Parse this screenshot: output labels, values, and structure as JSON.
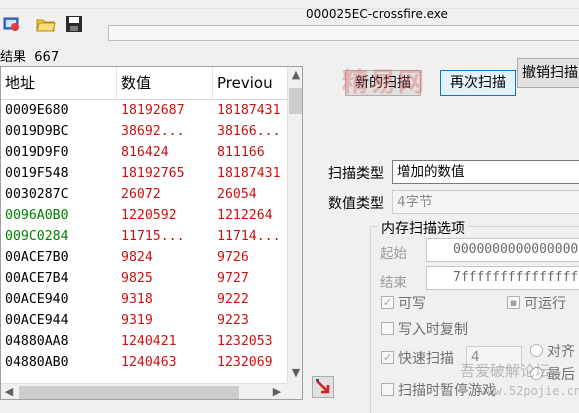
{
  "process_title": "000025EC-crossfire.exe",
  "toolbar": {
    "icons": [
      "process-select-icon",
      "open-file-icon",
      "save-icon"
    ]
  },
  "results": {
    "label": "结果",
    "count": "667"
  },
  "list": {
    "headers": {
      "address": "地址",
      "value": "数值",
      "previous": "Previou"
    },
    "rows": [
      {
        "address": "0009E680",
        "value": "18192687",
        "previous": "18187431",
        "color": "#000000"
      },
      {
        "address": "0019D9BC",
        "value": "38692...",
        "previous": "38166...",
        "color": "#000000"
      },
      {
        "address": "0019D9F0",
        "value": "816424",
        "previous": "811166",
        "color": "#000000"
      },
      {
        "address": "0019F548",
        "value": "18192765",
        "previous": "18187431",
        "color": "#000000"
      },
      {
        "address": "0030287C",
        "value": "26072",
        "previous": "26054",
        "color": "#000000"
      },
      {
        "address": "0096A0B0",
        "value": "1220592",
        "previous": "1212264",
        "color": "#008000"
      },
      {
        "address": "009C0284",
        "value": "11715...",
        "previous": "11714...",
        "color": "#008000"
      },
      {
        "address": "00ACE7B0",
        "value": "9824",
        "previous": "9726",
        "color": "#000000"
      },
      {
        "address": "00ACE7B4",
        "value": "9825",
        "previous": "9727",
        "color": "#000000"
      },
      {
        "address": "00ACE940",
        "value": "9318",
        "previous": "9222",
        "color": "#000000"
      },
      {
        "address": "00ACE944",
        "value": "9319",
        "previous": "9223",
        "color": "#000000"
      },
      {
        "address": "04880AA8",
        "value": "1240421",
        "previous": "1232053",
        "color": "#000000"
      },
      {
        "address": "04880AB0",
        "value": "1240463",
        "previous": "1232069",
        "color": "#000000"
      }
    ]
  },
  "buttons": {
    "new_scan": "新的扫描",
    "next_scan": "再次扫描",
    "undo_scan": "撤销扫描"
  },
  "scan_type": {
    "label": "扫描类型",
    "value": "增加的数值"
  },
  "value_type": {
    "label": "数值类型",
    "value": "4字节"
  },
  "memory_options": {
    "title": "内存扫描选项",
    "start_label": "起始",
    "start_value": "0000000000000000",
    "end_label": "结束",
    "end_value": "7fffffffffffffff",
    "writable": "可写",
    "executable": "可运行",
    "copy_on_write": "写入时复制",
    "fast_scan": "快速扫描",
    "fast_scan_value": "4",
    "align": "对齐",
    "last_digits": "最后",
    "pause_game": "扫描时暂停游戏"
  },
  "watermarks": {
    "top": "精易网",
    "bottom": "吾爱破解论坛",
    "url": "www.52pojie.cn"
  }
}
